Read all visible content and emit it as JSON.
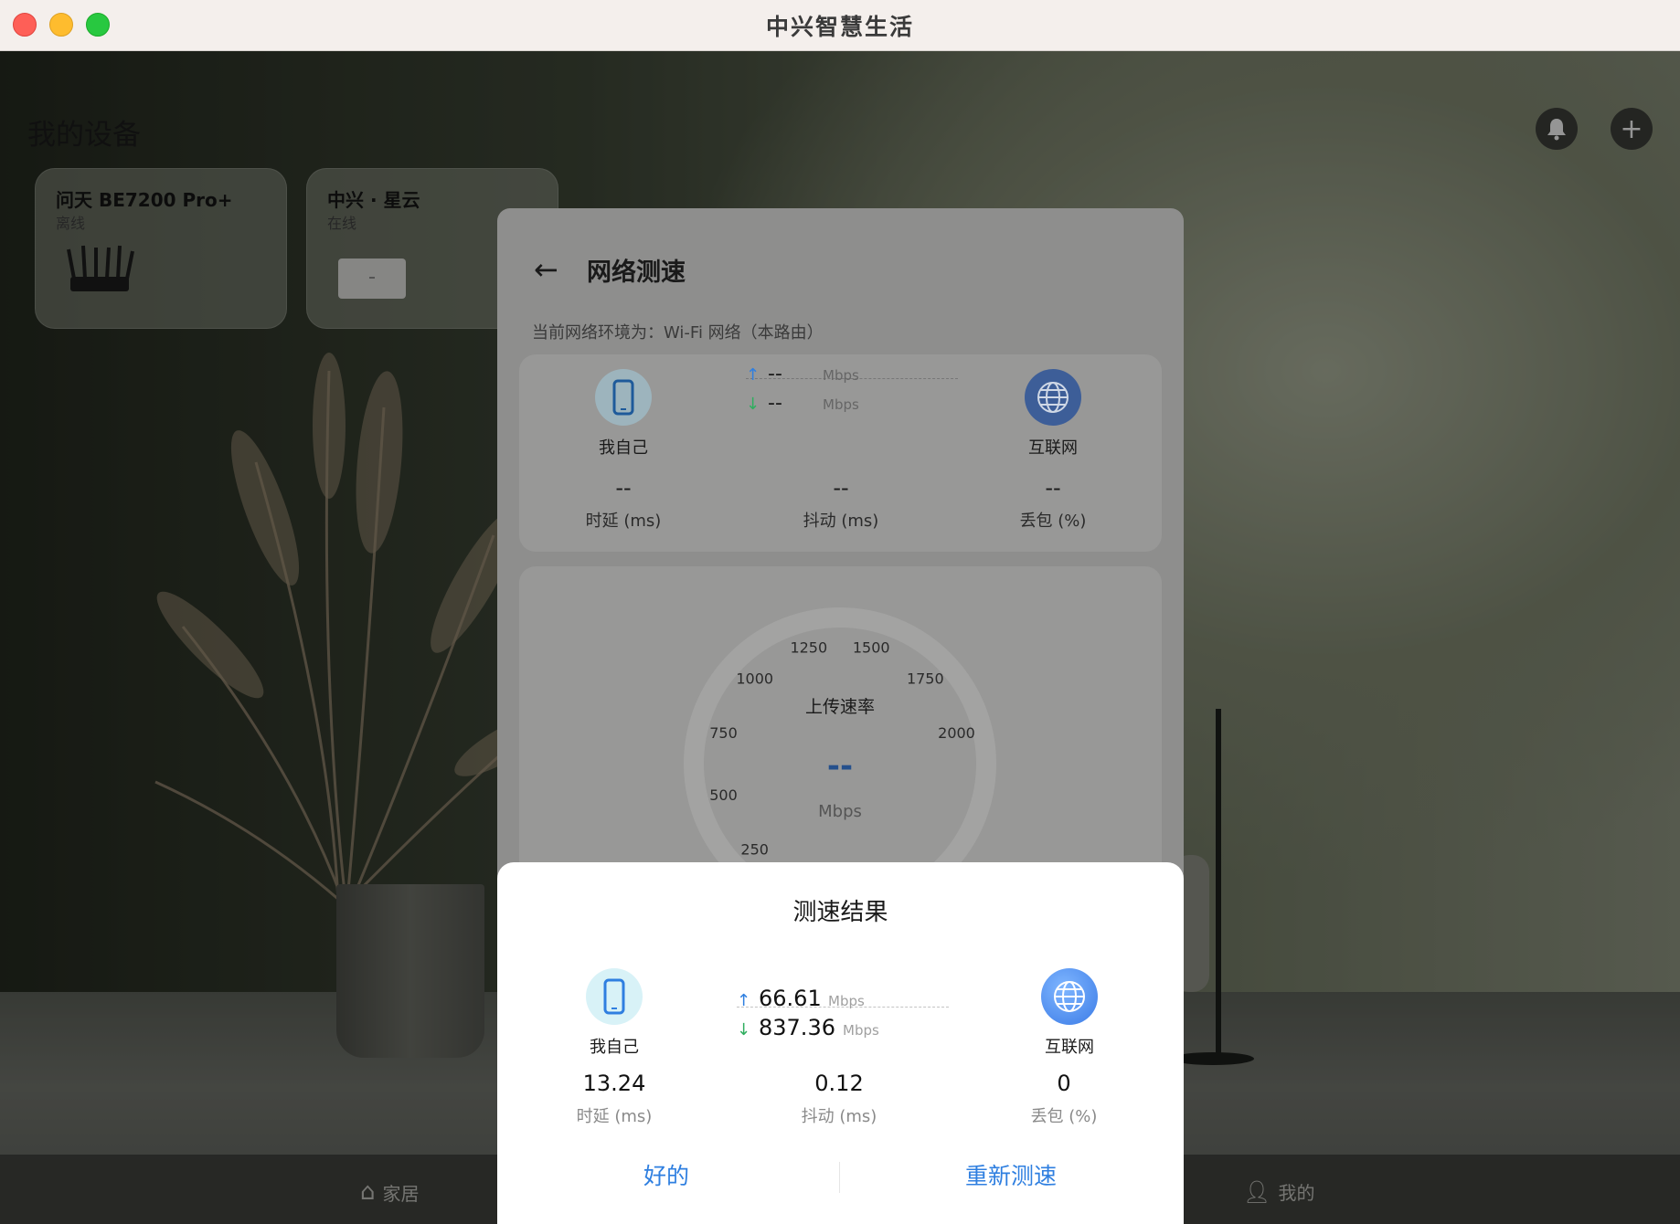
{
  "window": {
    "title": "中兴智慧生活"
  },
  "home": {
    "title": "我的设备",
    "devices": [
      {
        "name": "问天 BE7200 Pro+",
        "status": "离线"
      },
      {
        "name": "中兴 · 星云",
        "status": "在线"
      }
    ],
    "nav": {
      "home": "家居",
      "mine": "我的"
    }
  },
  "speedtest": {
    "title": "网络测速",
    "env": "当前网络环境为：Wi-Fi 网络（本路由）",
    "self_label": "我自己",
    "internet_label": "互联网",
    "up_value": "--",
    "down_value": "--",
    "unit": "Mbps",
    "latency_value": "--",
    "jitter_value": "--",
    "loss_value": "--",
    "latency_label": "时延 (ms)",
    "jitter_label": "抖动 (ms)",
    "loss_label": "丢包 (%)",
    "gauge": {
      "label": "上传速率",
      "value": "--",
      "unit": "Mbps",
      "ticks": [
        "250",
        "500",
        "750",
        "1000",
        "1250",
        "1500",
        "1750",
        "2000"
      ]
    }
  },
  "result": {
    "title": "测速结果",
    "self_label": "我自己",
    "internet_label": "互联网",
    "up_value": "66.61",
    "down_value": "837.36",
    "unit": "Mbps",
    "latency_value": "13.24",
    "jitter_value": "0.12",
    "loss_value": "0",
    "latency_label": "时延 (ms)",
    "jitter_label": "抖动 (ms)",
    "loss_label": "丢包 (%)",
    "ok_label": "好的",
    "retest_label": "重新测速"
  },
  "colors": {
    "accent": "#2f7fe0",
    "download": "#2fae5f",
    "gauge_needle": "#e08a1e"
  }
}
